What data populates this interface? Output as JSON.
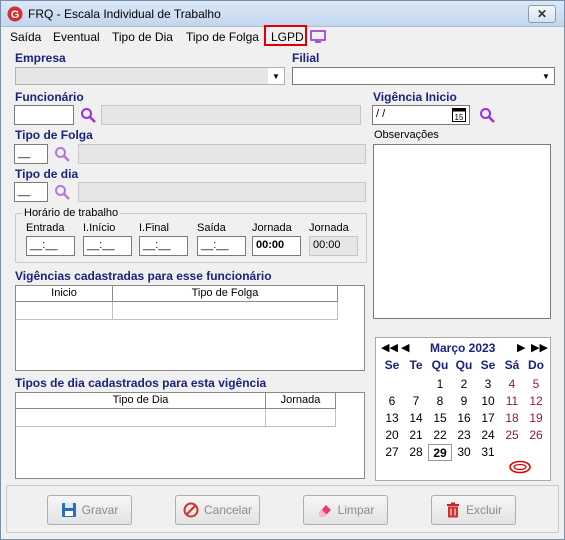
{
  "window": {
    "title": "FRQ - Escala Individual de Trabalho",
    "close_label": "✕"
  },
  "menu": {
    "items": [
      {
        "label": "Saída"
      },
      {
        "label": "Eventual"
      },
      {
        "label": "Tipo de Dia"
      },
      {
        "label": "Tipo de Folga"
      },
      {
        "label": "LGPD"
      }
    ]
  },
  "form": {
    "empresa_label": "Empresa",
    "filial_label": "Filial",
    "funcionario_label": "Funcionário",
    "vigencia_label": "Vigência Inicio",
    "vigencia_value": " / /",
    "tipo_folga_label": "Tipo de Folga",
    "tipo_folga_value": "__",
    "tipo_dia_label": "Tipo de dia",
    "tipo_dia_value": "__",
    "observacoes_label": "Observações"
  },
  "horario": {
    "title": "Horário de trabalho",
    "fields": [
      {
        "label": "Entrada",
        "value": "__:__"
      },
      {
        "label": "I.Início",
        "value": "__:__"
      },
      {
        "label": "I.Final",
        "value": "__:__"
      },
      {
        "label": "Saída",
        "value": "__:__"
      },
      {
        "label": "Jornada",
        "value": "00:00"
      },
      {
        "label": "Jornada",
        "value": "00:00"
      }
    ]
  },
  "vigencias": {
    "title": "Vigências cadastradas para esse funcionário",
    "columns": [
      "Inicio",
      "Tipo de Folga"
    ]
  },
  "tipos_dia": {
    "title": "Tipos de dia cadastrados para esta vigência",
    "columns": [
      "Tipo de Dia",
      "Jornada"
    ]
  },
  "calendar": {
    "month_label": "Março 2023",
    "weekdays": [
      "Se",
      "Te",
      "Qu",
      "Qu",
      "Se",
      "Sá",
      "Do"
    ],
    "weeks": [
      [
        "",
        "",
        "1",
        "2",
        "3",
        "4",
        "5"
      ],
      [
        "6",
        "7",
        "8",
        "9",
        "10",
        "11",
        "12"
      ],
      [
        "13",
        "14",
        "15",
        "16",
        "17",
        "18",
        "19"
      ],
      [
        "20",
        "21",
        "22",
        "23",
        "24",
        "25",
        "26"
      ],
      [
        "27",
        "28",
        "29",
        "30",
        "31",
        "",
        ""
      ]
    ],
    "today": "29",
    "weekend_color": "#8b1a3f"
  },
  "buttons": {
    "gravar": "Gravar",
    "cancelar": "Cancelar",
    "limpar": "Limpar",
    "excluir": "Excluir"
  },
  "colors": {
    "label_blue": "#1a237e",
    "highlight_red": "#e00000",
    "accent_purple": "#9b30d9"
  }
}
